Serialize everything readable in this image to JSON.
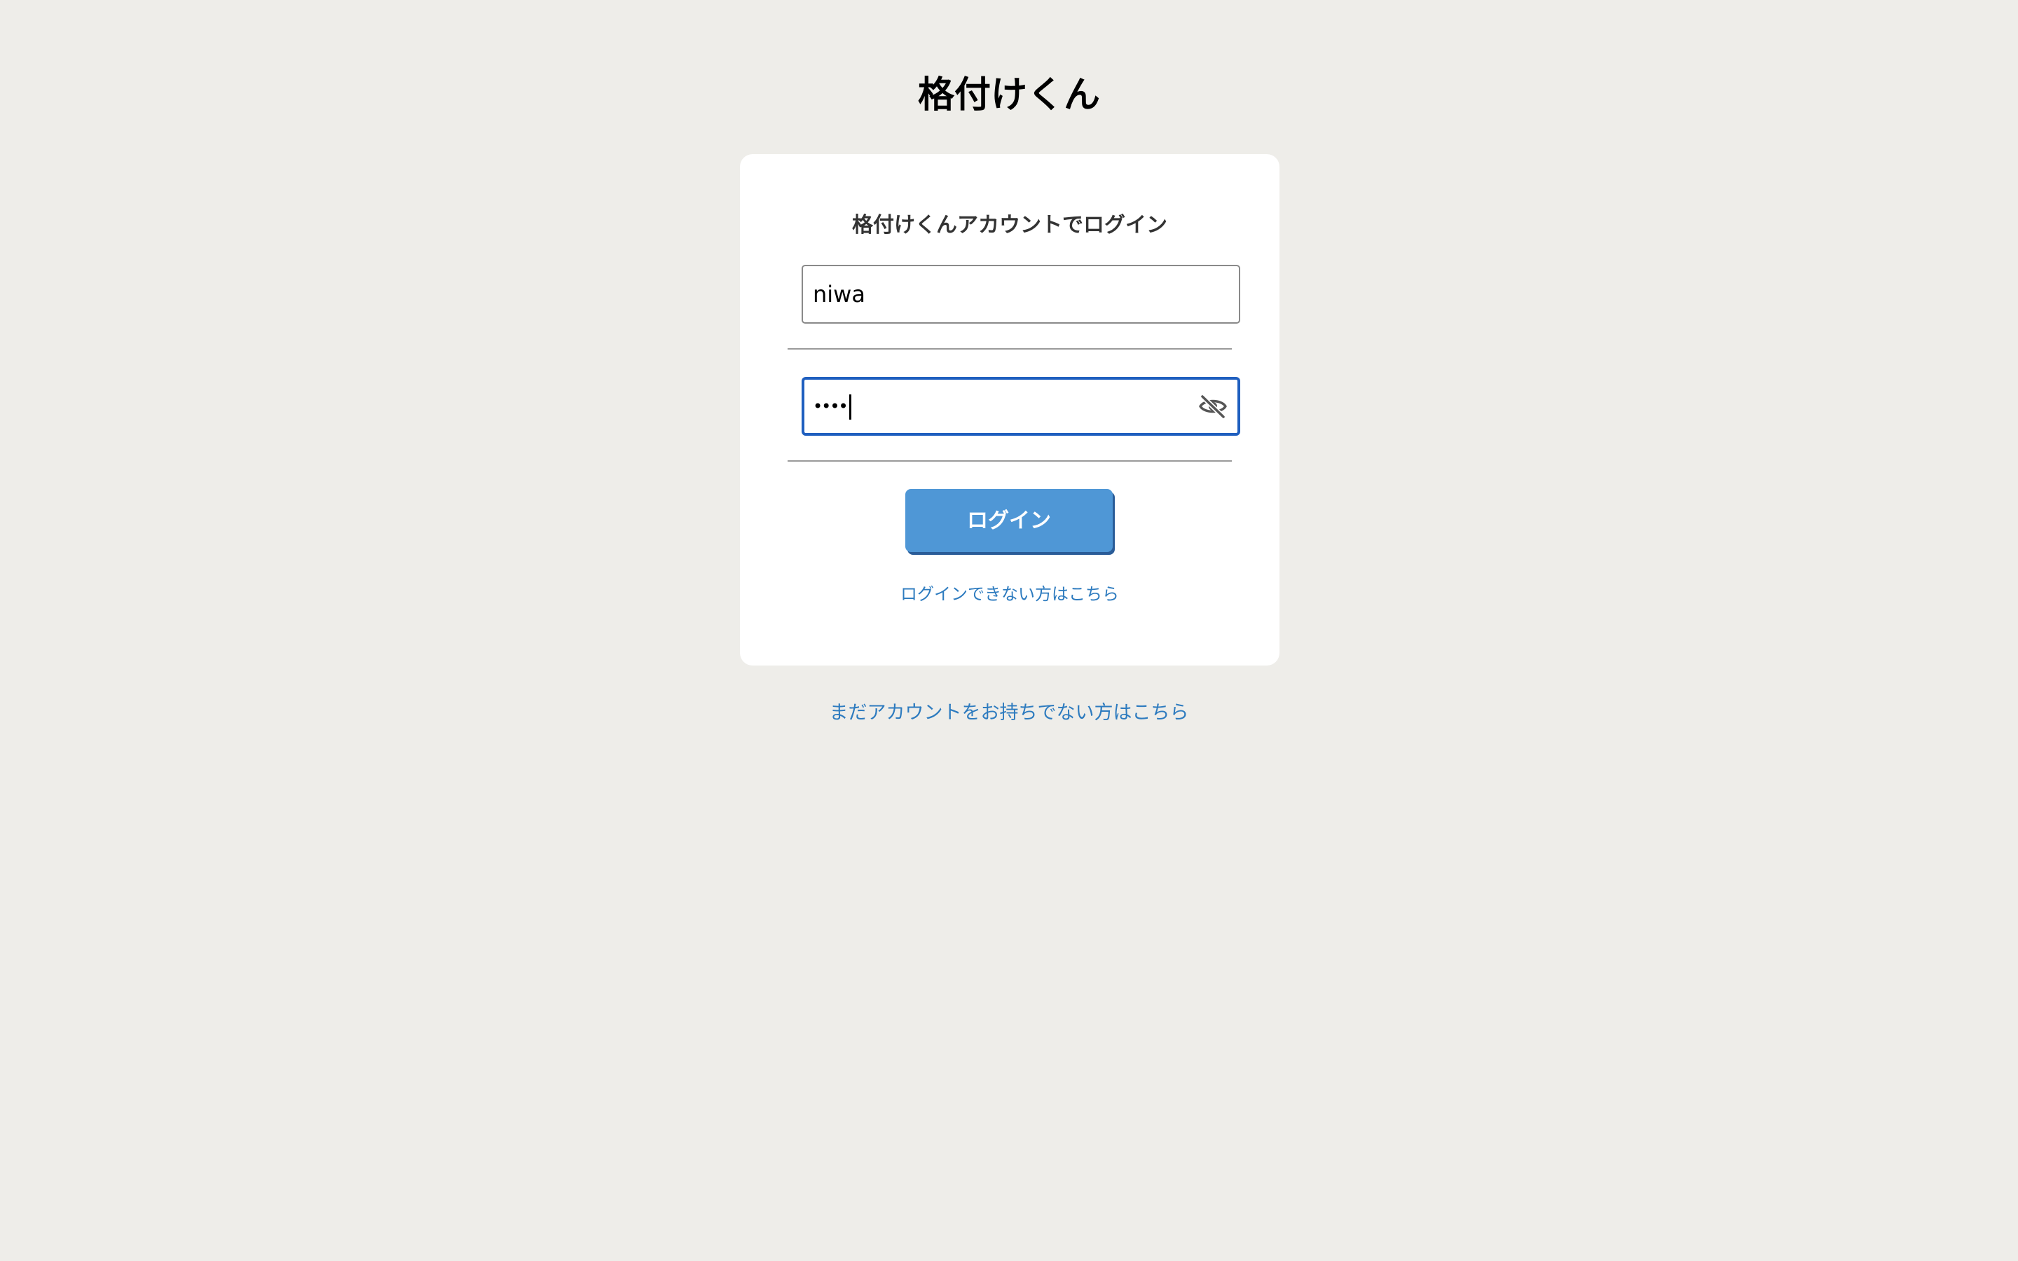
{
  "app": {
    "title": "格付けくん"
  },
  "login_card": {
    "heading": "格付けくんアカウントでログイン",
    "username_value": "niwa",
    "password_masked": "••••",
    "toggle_icon": "eye-slash-icon",
    "login_button_label": "ログイン",
    "forgot_link_label": "ログインできない方はこちら"
  },
  "signup_link_label": "まだアカウントをお持ちでない方はこちら",
  "colors": {
    "page_background": "#eeede9",
    "card_background": "#ffffff",
    "button_background": "#4f97d6",
    "focus_border": "#1f5fbf",
    "link": "#2d7bbf"
  }
}
